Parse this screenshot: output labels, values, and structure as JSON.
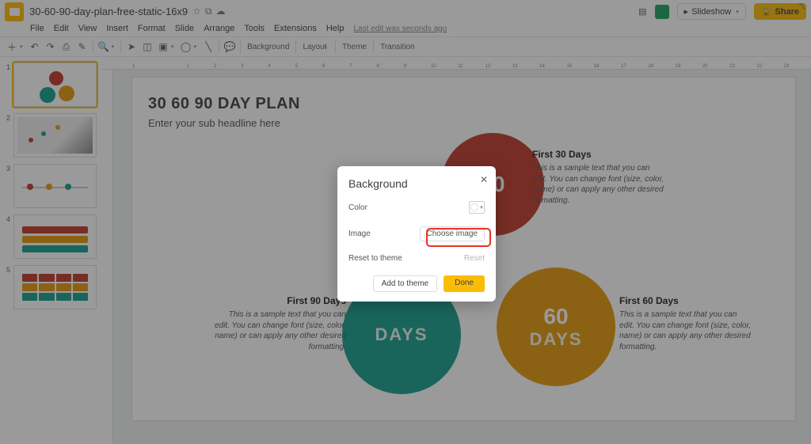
{
  "doc_title": "30-60-90-day-plan-free-static-16x9",
  "menus": [
    "File",
    "Edit",
    "View",
    "Insert",
    "Format",
    "Slide",
    "Arrange",
    "Tools",
    "Extensions",
    "Help"
  ],
  "last_edit": "Last edit was seconds ago",
  "slideshow_label": "Slideshow",
  "share_label": "Share",
  "toolbar_labels": {
    "background": "Background",
    "layout": "Layout",
    "theme": "Theme",
    "transition": "Transition"
  },
  "ruler_ticks": [
    "1",
    "",
    "1",
    "2",
    "3",
    "4",
    "5",
    "6",
    "7",
    "8",
    "9",
    "10",
    "11",
    "12",
    "13",
    "14",
    "15",
    "16",
    "17",
    "18",
    "19",
    "20",
    "21",
    "22",
    "23"
  ],
  "slide": {
    "title": "30 60 90 DAY PLAN",
    "subtitle": "Enter your sub headline here",
    "c1_num": "30",
    "c2_num": "60",
    "c3_num_partial": "DAYS",
    "days_label": "DAYS",
    "blocks": {
      "b1_h": "First 30 Days",
      "b1_p": "This is a sample text that you can edit. You can change font (size, color, name) or can apply any other desired formatting.",
      "b2_h": "First 60 Days",
      "b2_p": "This is a sample text that you can edit. You can change font (size, color, name) or can apply any other desired formatting.",
      "b3_h": "First 90 Days",
      "b3_p": "This is a sample text that you can edit. You can change font (size, color, name) or can apply any other desired formatting."
    }
  },
  "dialog": {
    "title": "Background",
    "color_label": "Color",
    "image_label": "Image",
    "choose_image": "Choose image",
    "reset_label": "Reset to theme",
    "reset_btn": "Reset",
    "add_to_theme": "Add to theme",
    "done": "Done"
  },
  "thumbs": [
    "1",
    "2",
    "3",
    "4",
    "5"
  ]
}
